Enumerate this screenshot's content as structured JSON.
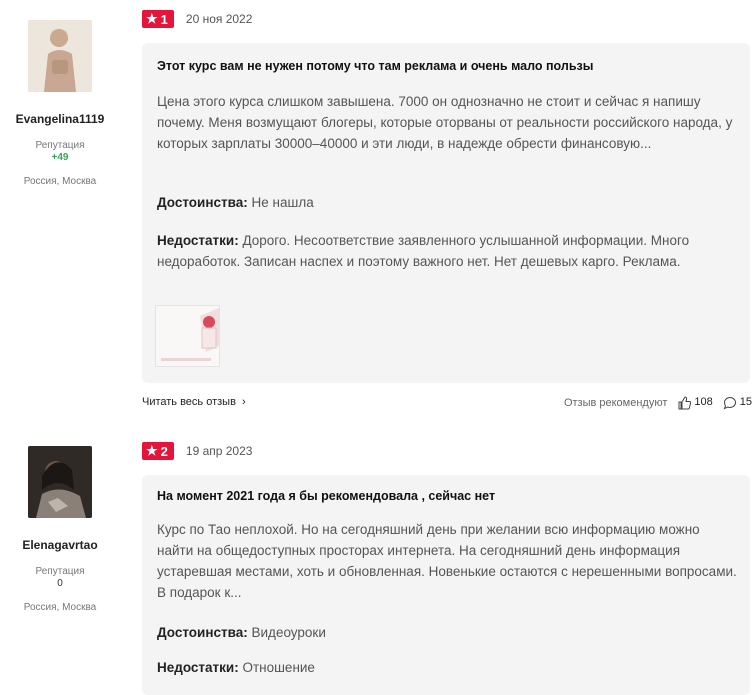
{
  "reviews": [
    {
      "author": {
        "name": "Evangelina1119",
        "reputation_label": "Репутация",
        "reputation_value": "+49",
        "city": "Россия, Москва"
      },
      "rating": "1",
      "date": "20 ноя 2022",
      "title": "Этот курс вам не нужен потому что там реклама и очень мало пользы",
      "text": "Цена этого курса слишком завышена. 7000 он однозначно не стоит и сейчас я напишу почему. Меня возмущают блогеры, которые оторваны от реальности российского народа, у которых зарплаты 30000–40000 и эти люди, в надежде обрести финансовую...",
      "pros_label": "Достоинства:",
      "pros": "Не нашла",
      "cons_label": "Недостатки:",
      "cons": "Дорого. Несоответствие заявленного услышанной информации. Много недоработок. Записан наспех и поэтому важного нет. Нет дешевых карго. Реклама.",
      "thumbnail_text": "ОМАЦИЯ ЕКЦИИ",
      "read_more": "Читать весь отзыв",
      "recommend_label": "Отзыв рекомендуют",
      "likes": "108",
      "comments": "15"
    },
    {
      "author": {
        "name": "Elenagavrtao",
        "reputation_label": "Репутация",
        "reputation_value": "0",
        "city": "Россия, Москва"
      },
      "rating": "2",
      "date": "19 апр 2023",
      "title": "На момент 2021 года я бы рекомендовала , сейчас нет",
      "text": "Курс по Тао неплохой. Но на сегодняшний день при желании всю информацию можно найти на общедоступных просторах интернета. На сегодняшний день информация устаревшая местами, хоть и обновленная. Новенькие остаются с нерешенными вопросами. В подарок к...",
      "pros_label": "Достоинства:",
      "pros": "Видеоуроки",
      "cons_label": "Недостатки:",
      "cons": "Отношение"
    }
  ],
  "colors": {
    "accent": "#e3153b",
    "positive": "#3aa35b",
    "card_bg": "#f4f4f5"
  }
}
